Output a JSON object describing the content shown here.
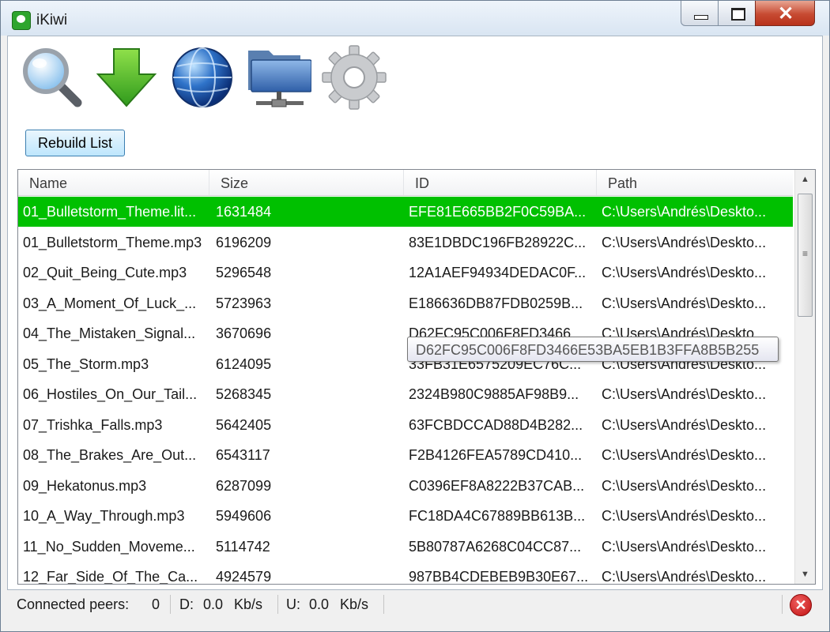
{
  "window": {
    "title": "iKiwi",
    "minimize_glyph": "",
    "maximize_glyph": "",
    "close_glyph": "✕"
  },
  "toolbar": {
    "icons": [
      "search-icon",
      "download-icon",
      "globe-icon",
      "shared-folder-icon",
      "settings-gear-icon"
    ]
  },
  "rebuild_button": {
    "label": "Rebuild List"
  },
  "list": {
    "columns": [
      "Name",
      "Size",
      "ID",
      "Path"
    ],
    "rows": [
      {
        "name": "01_Bulletstorm_Theme.lit...",
        "size": "1631484",
        "id": "EFE81E665BB2F0C59BA...",
        "path": "C:\\Users\\Andrés\\Deskto...",
        "selected": true
      },
      {
        "name": "01_Bulletstorm_Theme.mp3",
        "size": "6196209",
        "id": "83E1DBDC196FB28922C...",
        "path": "C:\\Users\\Andrés\\Deskto..."
      },
      {
        "name": "02_Quit_Being_Cute.mp3",
        "size": "5296548",
        "id": "12A1AEF94934DEDAC0F...",
        "path": "C:\\Users\\Andrés\\Deskto..."
      },
      {
        "name": "03_A_Moment_Of_Luck_...",
        "size": "5723963",
        "id": "E186636DB87FDB0259B...",
        "path": "C:\\Users\\Andrés\\Deskto..."
      },
      {
        "name": "04_The_Mistaken_Signal...",
        "size": "3670696",
        "id": "D62FC95C006F8FD3466...",
        "path": "C:\\Users\\Andrés\\Deskto..."
      },
      {
        "name": "05_The_Storm.mp3",
        "size": "6124095",
        "id": "33FB31E6575209EC76C...",
        "path": "C:\\Users\\Andrés\\Deskto..."
      },
      {
        "name": "06_Hostiles_On_Our_Tail...",
        "size": "5268345",
        "id": "2324B980C9885AF98B9...",
        "path": "C:\\Users\\Andrés\\Deskto..."
      },
      {
        "name": "07_Trishka_Falls.mp3",
        "size": "5642405",
        "id": "63FCBDCCAD88D4B282...",
        "path": "C:\\Users\\Andrés\\Deskto..."
      },
      {
        "name": "08_The_Brakes_Are_Out...",
        "size": "6543117",
        "id": "F2B4126FEA5789CD410...",
        "path": "C:\\Users\\Andrés\\Deskto..."
      },
      {
        "name": "09_Hekatonus.mp3",
        "size": "6287099",
        "id": "C0396EF8A8222B37CAB...",
        "path": "C:\\Users\\Andrés\\Deskto..."
      },
      {
        "name": "10_A_Way_Through.mp3",
        "size": "5949606",
        "id": "FC18DA4C67889BB613B...",
        "path": "C:\\Users\\Andrés\\Deskto..."
      },
      {
        "name": "11_No_Sudden_Moveme...",
        "size": "5114742",
        "id": "5B80787A6268C04CC87...",
        "path": "C:\\Users\\Andrés\\Deskto..."
      },
      {
        "name": "12_Far_Side_Of_The_Ca...",
        "size": "4924579",
        "id": "987BB4CDEBEB9B30E67...",
        "path": "C:\\Users\\Andrés\\Deskto..."
      }
    ],
    "scrollbar": {
      "up_glyph": "▲",
      "down_glyph": "▼",
      "grip_glyph": "≡"
    }
  },
  "tooltip": {
    "text": "D62FC95C006F8FD3466E53BA5EB1B3FFA8B5B255"
  },
  "status": {
    "peers_label": "Connected peers:",
    "peers_value": "0",
    "down_label": "D:",
    "down_value": "0.0",
    "down_unit": "Kb/s",
    "up_label": "U:",
    "up_value": "0.0",
    "up_unit": "Kb/s",
    "error_glyph": "✕"
  },
  "colors": {
    "selection": "#00c000",
    "accent_green": "#2ea52e",
    "close_red": "#c74a32"
  }
}
